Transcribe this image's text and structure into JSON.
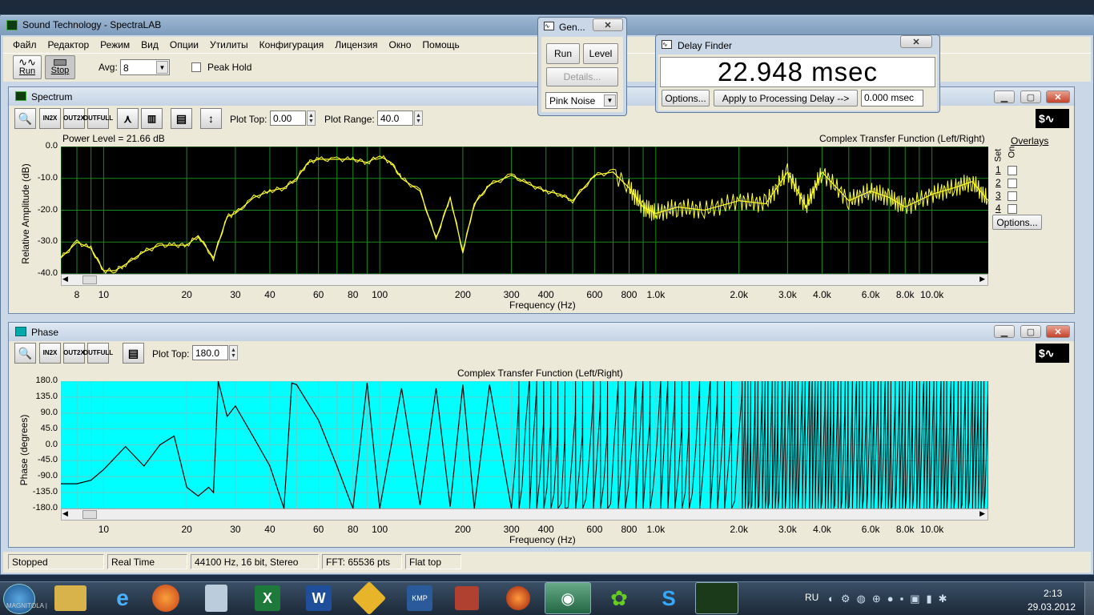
{
  "app": {
    "title": "Sound Technology - SpectraLAB",
    "menu": [
      "Файл",
      "Редактор",
      "Режим",
      "Вид",
      "Опции",
      "Утилиты",
      "Конфигурация",
      "Лицензия",
      "Окно",
      "Помощь"
    ],
    "toolbar": {
      "run_label": "Run",
      "stop_label": "Stop",
      "avg_label": "Avg:",
      "avg_value": "8",
      "peak_hold_label": "Peak Hold"
    }
  },
  "spectrum": {
    "title": "Spectrum",
    "plot_top_label": "Plot Top:",
    "plot_top_value": "0.00",
    "plot_range_label": "Plot Range:",
    "plot_range_value": "40.0",
    "power_level": "Power Level = 21.66 dB",
    "chart_title": "Complex Transfer Function (Left/Right)",
    "ylabel": "Relative Amplitude (dB)",
    "xlabel": "Frequency (Hz)",
    "yticks": [
      "0.0",
      "-10.0",
      "-20.0",
      "-30.0",
      "-40.0"
    ],
    "xticks": [
      "8",
      "10",
      "20",
      "30",
      "40",
      "60",
      "80",
      "100",
      "200",
      "300",
      "400",
      "600",
      "800",
      "1.0k",
      "2.0k",
      "3.0k",
      "4.0k",
      "6.0k",
      "8.0k",
      "10.0k"
    ],
    "overlays": {
      "title": "Overlays",
      "set_label": "Set",
      "on_label": "On",
      "rows": [
        "1",
        "2",
        "3",
        "4"
      ],
      "options_label": "Options..."
    },
    "zoom_buttons": [
      {
        "top": "IN",
        "bot": "2X"
      },
      {
        "top": "OUT",
        "bot": "2X"
      },
      {
        "top": "OUT",
        "bot": "FULL"
      }
    ]
  },
  "phase": {
    "title": "Phase",
    "plot_top_label": "Plot Top:",
    "plot_top_value": "180.0",
    "chart_title": "Complex Transfer Function (Left/Right)",
    "ylabel": "Phase (degrees)",
    "xlabel": "Frequency (Hz)",
    "yticks": [
      "180.0",
      "135.0",
      "90.0",
      "45.0",
      "0.0",
      "-45.0",
      "-90.0",
      "-135.0",
      "-180.0"
    ],
    "xticks": [
      "10",
      "20",
      "30",
      "40",
      "60",
      "80",
      "100",
      "200",
      "300",
      "400",
      "600",
      "800",
      "1.0k",
      "2.0k",
      "3.0k",
      "4.0k",
      "6.0k",
      "8.0k",
      "10.0k"
    ]
  },
  "generator": {
    "title": "Gen...",
    "run_label": "Run",
    "level_label": "Level",
    "details_label": "Details...",
    "signal": "Pink Noise"
  },
  "delay_finder": {
    "title": "Delay Finder",
    "value": "22.948 msec",
    "options_label": "Options...",
    "apply_label": "Apply to Processing Delay -->",
    "delay_value": "0.000 msec"
  },
  "statusbar": [
    "Stopped",
    "Real Time",
    "44100 Hz, 16 bit, Stereo",
    "FFT: 65536 pts",
    "Flat top"
  ],
  "taskbar": {
    "lang": "RU",
    "time": "2:13",
    "date": "29.03.2012",
    "watermark": "MAGNITOLA | "
  },
  "chart_data": [
    {
      "type": "line",
      "title": "Complex Transfer Function (Left/Right)",
      "xlabel": "Frequency (Hz)",
      "ylabel": "Relative Amplitude (dB)",
      "ylim": [
        -40,
        0
      ],
      "xscale": "log",
      "xlim": [
        7,
        16000
      ],
      "grid": true,
      "series": [
        {
          "x": [
            7,
            8,
            9,
            10,
            11,
            12,
            14,
            16,
            18,
            20,
            22,
            25,
            28,
            30,
            35,
            40,
            45,
            50,
            55,
            60,
            70,
            80,
            90,
            100,
            110,
            120,
            140,
            160,
            180,
            200,
            220,
            250,
            300,
            350,
            400,
            450,
            500,
            600,
            700,
            800,
            900,
            1000,
            1200,
            1500,
            2000,
            2500,
            3000,
            3500,
            4000,
            5000,
            6000,
            7000,
            8000,
            10000,
            12000,
            14000,
            16000
          ],
          "y": [
            -35,
            -30,
            -32,
            -39,
            -39,
            -37,
            -33,
            -31,
            -31,
            -31,
            -28,
            -35,
            -22,
            -21,
            -16,
            -14,
            -13,
            -10,
            -5,
            -4,
            -4,
            -4,
            -5,
            -3,
            -5,
            -10,
            -14,
            -29,
            -16,
            -33,
            -18,
            -12,
            -9,
            -12,
            -14,
            -15,
            -17,
            -9,
            -8,
            -13,
            -19,
            -21,
            -19,
            -20,
            -17,
            -18,
            -8,
            -19,
            -8,
            -17,
            -14,
            -16,
            -19,
            -15,
            -13,
            -11,
            -17
          ]
        }
      ]
    },
    {
      "type": "line",
      "title": "Complex Transfer Function (Left/Right)",
      "xlabel": "Frequency (Hz)",
      "ylabel": "Phase (degrees)",
      "ylim": [
        -180,
        180
      ],
      "xscale": "log",
      "xlim": [
        7,
        16000
      ],
      "grid": true,
      "series": [
        {
          "x": [
            7,
            8,
            9,
            10,
            12,
            14,
            16,
            18,
            20,
            22,
            24,
            25,
            26,
            28,
            30,
            35,
            40,
            45,
            48,
            50,
            60,
            70,
            80,
            90,
            100,
            120,
            140,
            160,
            180,
            200,
            220,
            250,
            300
          ],
          "y": [
            -110,
            -110,
            -100,
            -70,
            -5,
            -60,
            0,
            25,
            -120,
            -145,
            -120,
            -135,
            180,
            80,
            110,
            20,
            -60,
            -180,
            175,
            170,
            70,
            -60,
            -180,
            175,
            -180,
            160,
            -170,
            160,
            -175,
            170,
            -180,
            170,
            -180
          ]
        }
      ]
    }
  ]
}
